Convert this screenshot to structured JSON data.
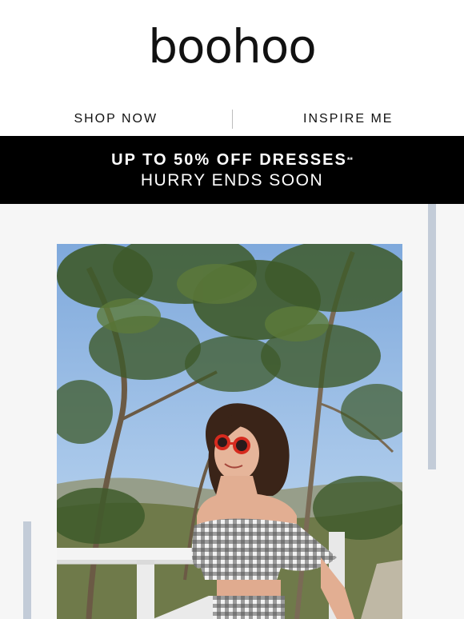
{
  "brand": {
    "logo_text": "boohoo"
  },
  "nav": {
    "shop_now": "SHOP NOW",
    "inspire_me": "INSPIRE ME"
  },
  "promo_banner": {
    "headline": "UP TO 50% OFF DRESSES",
    "footnote_mark": "**",
    "subline": "HURRY ENDS SOON"
  },
  "hero": {
    "image_label": "hero-photo"
  },
  "colors": {
    "banner_bg": "#000000",
    "accent_bar": "#c3ccd8",
    "section_bg": "#f6f6f6",
    "sunglasses": "#d62a1e"
  }
}
